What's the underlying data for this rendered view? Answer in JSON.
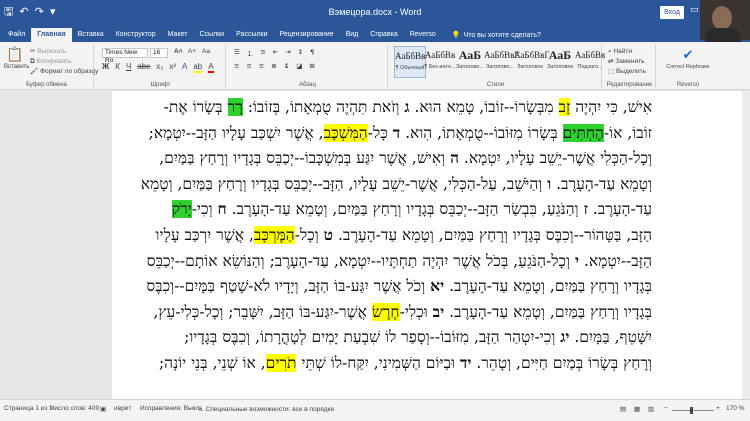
{
  "titlebar": {
    "document_title": "Вэмецора.docx - Word",
    "signin": "Вход",
    "qat_icons": [
      "save-icon",
      "undo-icon",
      "redo-icon",
      "customize-icon"
    ]
  },
  "tabs": [
    {
      "label": "Файл",
      "active": false
    },
    {
      "label": "Главная",
      "active": true
    },
    {
      "label": "Вставка",
      "active": false
    },
    {
      "label": "Конструктор",
      "active": false
    },
    {
      "label": "Макет",
      "active": false
    },
    {
      "label": "Ссылки",
      "active": false
    },
    {
      "label": "Рассылки",
      "active": false
    },
    {
      "label": "Рецензирование",
      "active": false
    },
    {
      "label": "Вид",
      "active": false
    },
    {
      "label": "Справка",
      "active": false
    },
    {
      "label": "Reverso",
      "active": false
    }
  ],
  "tell_me": "Что вы хотите сделать?",
  "share": "Поде",
  "ribbon": {
    "clipboard": {
      "paste": "Вставить",
      "cut": "Вырезать",
      "copy": "Копировать",
      "format_painter": "Формат по образцу",
      "label": "Буфер обмена"
    },
    "font": {
      "name": "Times New Ro",
      "size": "16",
      "label": "Шрифт"
    },
    "paragraph": {
      "label": "Абзац"
    },
    "styles": {
      "items": [
        {
          "preview": "АаБбВв",
          "label": "¶ Обычный",
          "selected": true
        },
        {
          "preview": "АаБбВв",
          "label": "¶ Без инте...",
          "selected": false
        },
        {
          "preview": "АаБ",
          "label": "Заголово...",
          "selected": false
        },
        {
          "preview": "АаБбВвГ",
          "label": "Заголово...",
          "selected": false
        },
        {
          "preview": "АаБбВвГ",
          "label": "Заголовок",
          "selected": false
        },
        {
          "preview": "АаБ",
          "label": "Заголовок",
          "selected": false
        },
        {
          "preview": "АаБбВв",
          "label": "Подзаго...",
          "selected": false
        }
      ],
      "label": "Стили"
    },
    "editing": {
      "find": "Найти",
      "replace": "Заменить",
      "select": "Выделить",
      "label": "Редактирование"
    },
    "reverso": {
      "button": "Correct Rephrase",
      "label": "Reverso"
    }
  },
  "document": {
    "lines": [
      [
        {
          "t": "אִישׁ, כִּי יִהְיֶה "
        },
        {
          "t": "זָב",
          "h": "y"
        },
        {
          "t": " מִבְּשָׂרוֹ--זוֹבוֹ, טָמֵא הוּא. "
        },
        {
          "t": "ג",
          "b": true
        },
        {
          "t": " וְזֹאת תִּהְיֶה טֻמְאָתוֹ, בְּזוֹבוֹ: "
        },
        {
          "t": "רָר",
          "h": "g"
        },
        {
          "t": " בְּשָׂרוֹ אֶת-"
        }
      ],
      [
        {
          "t": "זוֹבוֹ, אוֹ-"
        },
        {
          "t": "הֶחְתִּים",
          "h": "g"
        },
        {
          "t": " בְּשָׂרוֹ מִזּוֹבוֹ--טֻמְאָתוֹ, הִוא. "
        },
        {
          "t": "ד",
          "b": true
        },
        {
          "t": " כָּל-"
        },
        {
          "t": "הַמִּשְׁכָּב",
          "h": "y"
        },
        {
          "t": ", אֲשֶׁר יִשְׁכַּב עָלָיו הַזָּב--יִטְמָא;"
        }
      ],
      [
        {
          "t": "וְכָל-הַכְּלִי אֲשֶׁר-יֵשֵׁב עָלָיו, יִטְמָא. "
        },
        {
          "t": "ה",
          "b": true
        },
        {
          "t": " וְאִישׁ, אֲשֶׁר יִגַּע בְּמִשְׁכָּבוֹ--יְכַבֵּס בְּגָדָיו וְרָחַץ בַּמַּיִם,"
        }
      ],
      [
        {
          "t": "וְטָמֵא עַד-הָעָרֶב. "
        },
        {
          "t": "ו",
          "b": true
        },
        {
          "t": " וְהַיֹּשֵׁב, עַל-הַכְּלִי, אֲשֶׁר-יֵשֵׁב עָלָיו, הַזָּב--יְכַבֵּס בְּגָדָיו וְרָחַץ בַּמַּיִם, וְטָמֵא"
        }
      ],
      [
        {
          "t": "עַד-הָעָרֶב. "
        },
        {
          "t": "ז",
          "b": true
        },
        {
          "t": " וְהַנֹּגֵעַ, בִּבְשַׂר הַזָּב--יְכַבֵּס בְּגָדָיו וְרָחַץ בַּמַּיִם, וְטָמֵא עַד-הָעָרֶב. "
        },
        {
          "t": "ח",
          "b": true
        },
        {
          "t": " וְכִי-"
        },
        {
          "t": "יָרֹק",
          "h": "g"
        }
      ],
      [
        {
          "t": "הַזָּב, בַּטָּהוֹר--וְכִבֶּס בְּגָדָיו וְרָחַץ בַּמַּיִם, וְטָמֵא עַד-הָעָרֶב. "
        },
        {
          "t": "ט",
          "b": true
        },
        {
          "t": " וְכָל-"
        },
        {
          "t": "הַמֶּרְכָּב",
          "h": "y"
        },
        {
          "t": ", אֲשֶׁר יִרְכַּב עָלָיו"
        }
      ],
      [
        {
          "t": "הַזָּב--יִטְמָא. "
        },
        {
          "t": "י",
          "b": true
        },
        {
          "t": " וְכָל-הַנֹּגֵעַ, בְּכֹל אֲשֶׁר יִהְיֶה תַחְתָּיו--יִטְמָא, עַד-הָעָרֶב; וְהַנּוֹשֵׂא אוֹתָם--יְכַבֵּס"
        }
      ],
      [
        {
          "t": "בְּגָדָיו וְרָחַץ בַּמַּיִם, וְטָמֵא עַד-הָעָרֶב. "
        },
        {
          "t": "יא",
          "b": true
        },
        {
          "t": " וְכֹל אֲשֶׁר יִגַּע-בּוֹ הַזָּב, וְיָדָיו לֹא-שָׁטַף בַּמָּיִם--וְכִבֶּס"
        }
      ],
      [
        {
          "t": "בְּגָדָיו וְרָחַץ בַּמַּיִם, וְטָמֵא עַד-הָעָרֶב. "
        },
        {
          "t": "יב",
          "b": true
        },
        {
          "t": " וּכְלִי-"
        },
        {
          "t": "חֶרֶשׂ",
          "h": "y"
        },
        {
          "t": " אֲשֶׁר-יִגַּע-בּוֹ הַזָּב, יִשָּׁבֵר; וְכָל-כְּלִי-עֵץ,"
        }
      ],
      [
        {
          "t": "יִשָּׁטֵף, בַּמָּיִם. "
        },
        {
          "t": "יג",
          "b": true
        },
        {
          "t": " וְכִי-יִטְהַר הַזָּב, מִזּוֹבוֹ--וְסָפַר לוֹ שִׁבְעַת יָמִים לְטָהֳרָתוֹ, וְכִבֶּס בְּגָדָיו;"
        }
      ],
      [
        {
          "t": "וְרָחַץ בְּשָׂרוֹ בְּמַיִם חַיִּים, וְטָהֵר. "
        },
        {
          "t": "יד",
          "b": true
        },
        {
          "t": " וּבַיּוֹם הַשְּׁמִינִי, יִקַּח-לוֹ שְׁתֵּי "
        },
        {
          "t": "תֹרִים",
          "h": "y"
        },
        {
          "t": ", אוֹ שְׁנֵי, בְּנֵי יוֹנָה;"
        }
      ]
    ],
    "highlight_colors": {
      "y": "#ffff00",
      "g": "#2fd12f"
    }
  },
  "statusbar": {
    "page": "Страница 1 из 2",
    "words": "Число слов: 409",
    "lang": "иврит",
    "corrections": "Исправления: Выкл",
    "accessibility": "Специальные возможности: все в порядке",
    "zoom": "170 %"
  }
}
